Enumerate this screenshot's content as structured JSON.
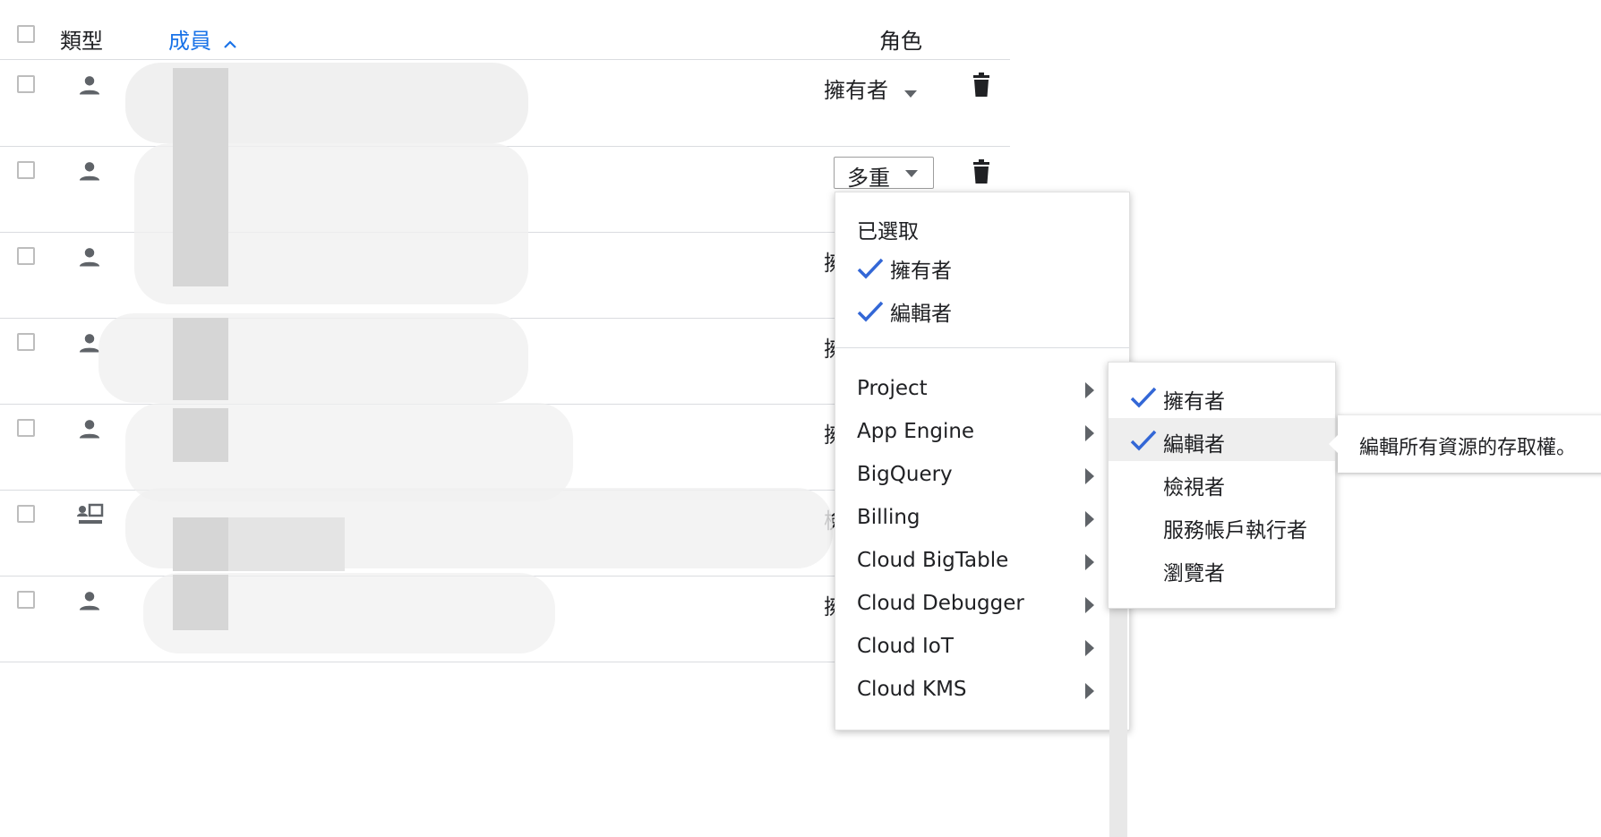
{
  "table": {
    "headers": {
      "type": "類型",
      "member": "成員",
      "role": "角色"
    },
    "rows": [
      {
        "type_icon": "person-icon",
        "role": "擁有者"
      },
      {
        "type_icon": "person-icon",
        "role": "多重"
      },
      {
        "type_icon": "person-icon",
        "role": "擁"
      },
      {
        "type_icon": "person-icon",
        "role": "擁"
      },
      {
        "type_icon": "person-icon",
        "role": "擁"
      },
      {
        "type_icon": "service-account-icon",
        "role": "檢"
      },
      {
        "type_icon": "person-icon",
        "role": "擁"
      }
    ]
  },
  "role_menu": {
    "selected_header": "已選取",
    "selected": [
      "擁有者",
      "編輯者"
    ],
    "categories": [
      "Project",
      "App Engine",
      "BigQuery",
      "Billing",
      "Cloud BigTable",
      "Cloud Debugger",
      "Cloud IoT",
      "Cloud KMS"
    ]
  },
  "submenu": {
    "items": [
      {
        "label": "擁有者",
        "checked": true
      },
      {
        "label": "編輯者",
        "checked": true,
        "highlighted": true
      },
      {
        "label": "檢視者",
        "checked": false
      },
      {
        "label": "服務帳戶執行者",
        "checked": false
      },
      {
        "label": "瀏覽者",
        "checked": false
      }
    ]
  },
  "tooltip": {
    "text": "編輯所有資源的存取權。"
  },
  "colors": {
    "accent": "#1a73e8",
    "check": "#3367d6",
    "icon": "#5f6368",
    "divider": "#dadce0"
  }
}
